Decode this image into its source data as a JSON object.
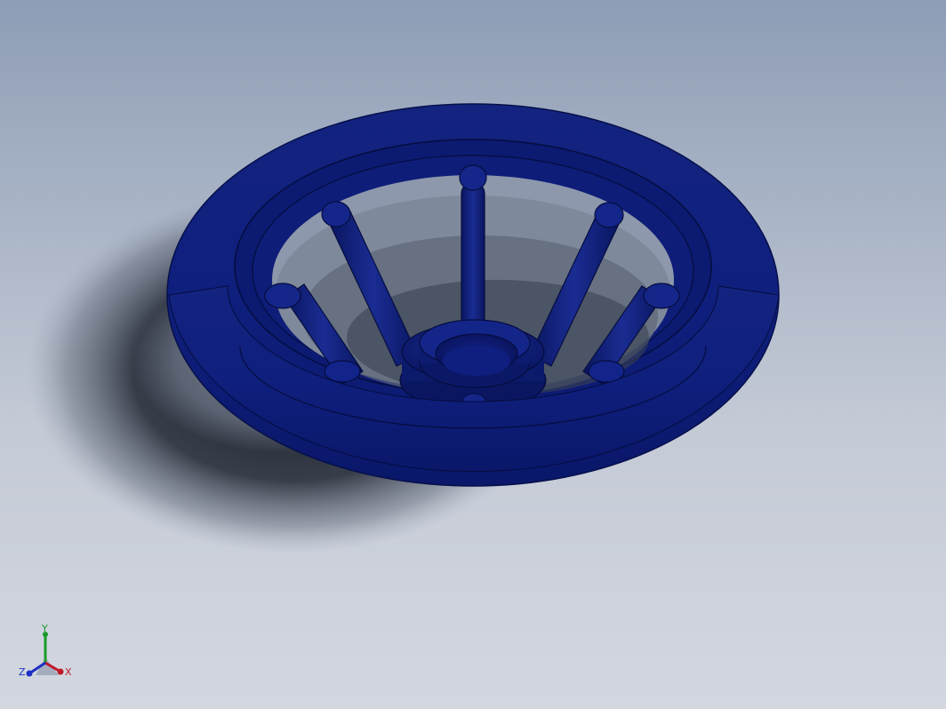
{
  "viewport": {
    "background_top": "#8e9db6",
    "background_bottom": "#d3d7df"
  },
  "model": {
    "name": "handwheel",
    "color": "#0f1f7d",
    "shade_color": "#081256",
    "highlight_color": "#2a3ea8",
    "spoke_count": 8
  },
  "triad": {
    "x_label": "X",
    "y_label": "Y",
    "z_label": "Z",
    "x_color": "#c0182a",
    "y_color": "#1a9a2a",
    "z_color": "#1d2fc4"
  }
}
